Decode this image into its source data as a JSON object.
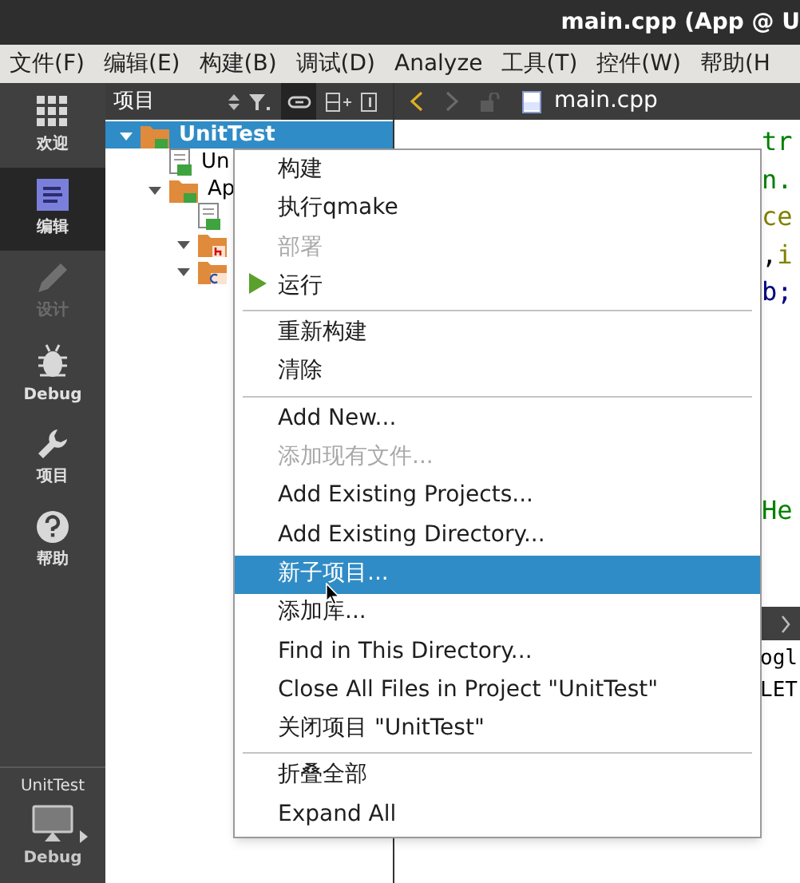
{
  "window": {
    "title": "main.cpp (App @ U"
  },
  "menubar": [
    "文件(F)",
    "编辑(E)",
    "构建(B)",
    "调试(D)",
    "Analyze",
    "工具(T)",
    "控件(W)",
    "帮助(H"
  ],
  "sidebar": {
    "items": [
      {
        "kind": "grid",
        "label": "欢迎",
        "selected": false,
        "disabled": false
      },
      {
        "kind": "edit",
        "label": "编辑",
        "selected": true,
        "disabled": false
      },
      {
        "kind": "pencil",
        "label": "设计",
        "selected": false,
        "disabled": true
      },
      {
        "kind": "bug",
        "label": "Debug",
        "selected": false,
        "disabled": false
      },
      {
        "kind": "wrench",
        "label": "项目",
        "selected": false,
        "disabled": false
      },
      {
        "kind": "help",
        "label": "帮助",
        "selected": false,
        "disabled": false
      }
    ],
    "target": {
      "project": "UnitTest",
      "config": "Debug"
    }
  },
  "projects": {
    "title": "项目",
    "tree": [
      {
        "kind": "project",
        "label": "UnitTest",
        "selected": true,
        "expanded": true,
        "children": [
          {
            "kind": "file",
            "label": "Un",
            "selected": false
          },
          {
            "kind": "project",
            "label": "Ap",
            "selected": false,
            "expanded": true,
            "children": [
              {
                "kind": "file",
                "selected": false
              },
              {
                "kind": "folder-h",
                "selected": false,
                "expanded": true
              },
              {
                "kind": "folder-cpp",
                "selected": false,
                "expanded": true
              }
            ]
          }
        ]
      }
    ]
  },
  "editor": {
    "file": "main.cpp",
    "code": [
      [
        {
          "text": "tr",
          "color": "#008000"
        }
      ],
      [
        {
          "text": "n.",
          "color": "#008000"
        }
      ],
      [
        {
          "text": "ce",
          "color": "#808000"
        }
      ],
      [
        {
          "text": ",",
          "color": "#000000"
        },
        {
          "text": "i",
          "color": "#808000"
        }
      ],
      [
        {
          "text": "b;",
          "color": "#000080"
        }
      ]
    ],
    "code_lower": [
      [
        {
          "text": "He",
          "color": "#008000"
        }
      ]
    ],
    "output": [
      "ogl",
      "LET"
    ]
  },
  "context_menu": [
    {
      "kind": "item",
      "label": "构建",
      "disabled": false,
      "selected": false
    },
    {
      "kind": "item",
      "label": "执行qmake",
      "disabled": false,
      "selected": false
    },
    {
      "kind": "item",
      "label": "部署",
      "disabled": true,
      "selected": false
    },
    {
      "kind": "play",
      "label": "运行",
      "disabled": false,
      "selected": false
    },
    {
      "kind": "separator"
    },
    {
      "kind": "item",
      "label": "重新构建",
      "disabled": false,
      "selected": false
    },
    {
      "kind": "item",
      "label": "清除",
      "disabled": false,
      "selected": false
    },
    {
      "kind": "separator"
    },
    {
      "kind": "item",
      "label": "Add New...",
      "disabled": false,
      "selected": false
    },
    {
      "kind": "item",
      "label": "添加现有文件...",
      "disabled": true,
      "selected": false
    },
    {
      "kind": "item",
      "label": "Add Existing Projects...",
      "disabled": false,
      "selected": false
    },
    {
      "kind": "item",
      "label": "Add Existing Directory...",
      "disabled": false,
      "selected": false
    },
    {
      "kind": "item",
      "label": "新子项目...",
      "disabled": false,
      "selected": true
    },
    {
      "kind": "item",
      "label": "添加库...",
      "disabled": false,
      "selected": false
    },
    {
      "kind": "item",
      "label": "Find in This Directory...",
      "disabled": false,
      "selected": false
    },
    {
      "kind": "item",
      "label": "Close All Files in Project \"UnitTest\"",
      "disabled": false,
      "selected": false
    },
    {
      "kind": "item",
      "label": "关闭项目 \"UnitTest\"",
      "disabled": false,
      "selected": false
    },
    {
      "kind": "separator"
    },
    {
      "kind": "item",
      "label": "折叠全部",
      "disabled": false,
      "selected": false
    },
    {
      "kind": "item",
      "label": "Expand All",
      "disabled": false,
      "selected": false
    }
  ]
}
